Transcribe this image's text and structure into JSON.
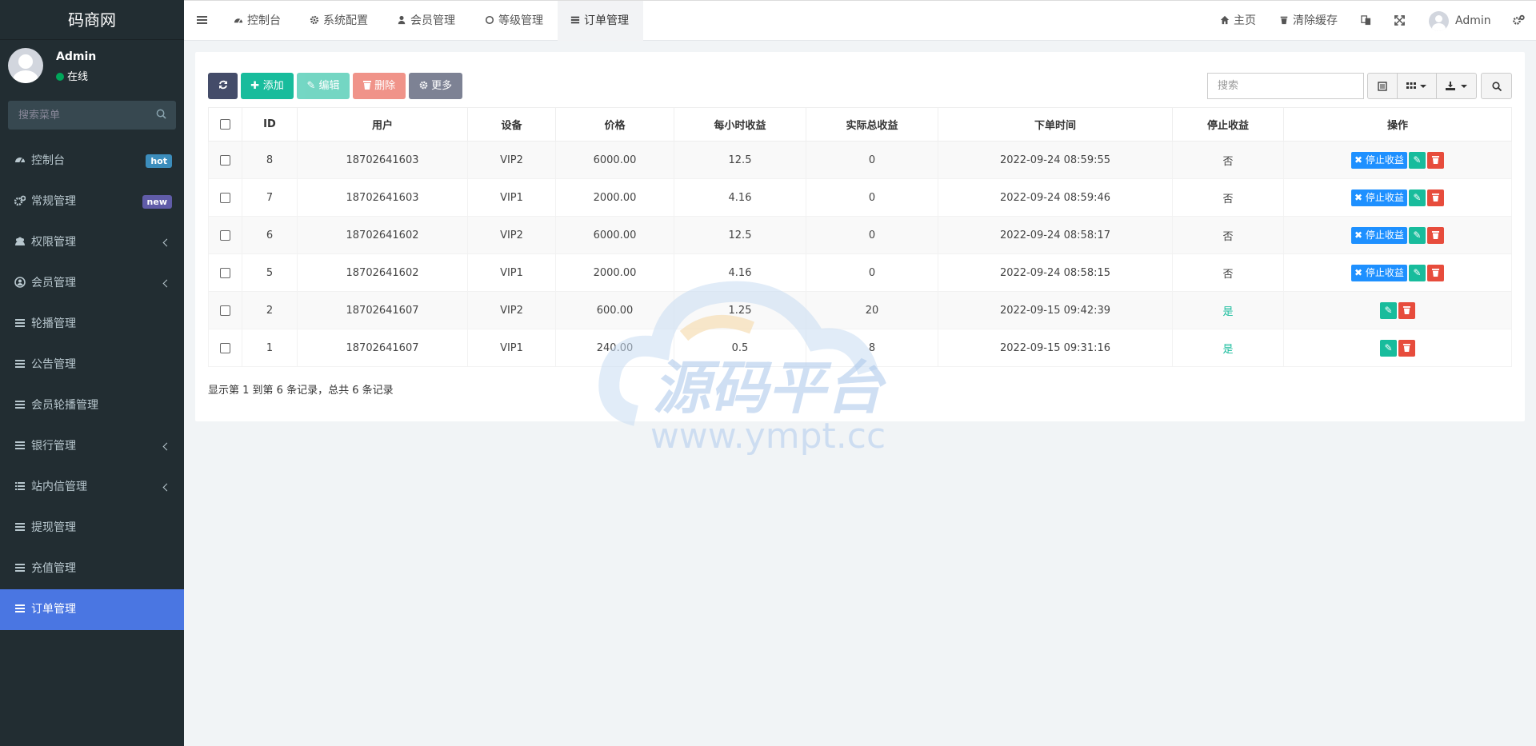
{
  "sidebar": {
    "logo": "码商网",
    "user": {
      "name": "Admin",
      "status": "在线"
    },
    "search_placeholder": "搜索菜单",
    "items": [
      {
        "label": "控制台",
        "badge": "hot"
      },
      {
        "label": "常规管理",
        "badge": "new"
      },
      {
        "label": "权限管理"
      },
      {
        "label": "会员管理"
      },
      {
        "label": "轮播管理"
      },
      {
        "label": "公告管理"
      },
      {
        "label": "会员轮播管理"
      },
      {
        "label": "银行管理"
      },
      {
        "label": "站内信管理"
      },
      {
        "label": "提现管理"
      },
      {
        "label": "充值管理"
      },
      {
        "label": "订单管理"
      }
    ]
  },
  "topbar": {
    "tabs": [
      "控制台",
      "系统配置",
      "会员管理",
      "等级管理",
      "订单管理"
    ],
    "home": "主页",
    "clear_cache": "清除缓存",
    "admin": "Admin"
  },
  "toolbar": {
    "add": "添加",
    "edit": "编辑",
    "delete": "删除",
    "more": "更多",
    "search_placeholder": "搜索"
  },
  "table": {
    "headers": [
      "ID",
      "用户",
      "设备",
      "价格",
      "每小时收益",
      "实际总收益",
      "下单时间",
      "停止收益",
      "操作"
    ],
    "rows": [
      {
        "id": "8",
        "user": "18702641603",
        "device": "VIP2",
        "price": "6000.00",
        "hourly": "12.5",
        "total": "0",
        "time": "2022-09-24 08:59:55",
        "stopped": "否"
      },
      {
        "id": "7",
        "user": "18702641603",
        "device": "VIP1",
        "price": "2000.00",
        "hourly": "4.16",
        "total": "0",
        "time": "2022-09-24 08:59:46",
        "stopped": "否"
      },
      {
        "id": "6",
        "user": "18702641602",
        "device": "VIP2",
        "price": "6000.00",
        "hourly": "12.5",
        "total": "0",
        "time": "2022-09-24 08:58:17",
        "stopped": "否"
      },
      {
        "id": "5",
        "user": "18702641602",
        "device": "VIP1",
        "price": "2000.00",
        "hourly": "4.16",
        "total": "0",
        "time": "2022-09-24 08:58:15",
        "stopped": "否"
      },
      {
        "id": "2",
        "user": "18702641607",
        "device": "VIP2",
        "price": "600.00",
        "hourly": "1.25",
        "total": "20",
        "time": "2022-09-15 09:42:39",
        "stopped": "是"
      },
      {
        "id": "1",
        "user": "18702641607",
        "device": "VIP1",
        "price": "240.00",
        "hourly": "0.5",
        "total": "8",
        "time": "2022-09-15 09:31:16",
        "stopped": "是"
      }
    ],
    "stop_label": "停止收益"
  },
  "pager": "显示第 1 到第 6 条记录，总共 6 条记录",
  "watermark": {
    "title": "源码平台",
    "url": "www.ympt.cc"
  },
  "colors": {
    "sidebar": "#222d32",
    "active": "#4a76e2",
    "success": "#18bc9c",
    "danger": "#e74c3c",
    "primary": "#1e90ff"
  }
}
